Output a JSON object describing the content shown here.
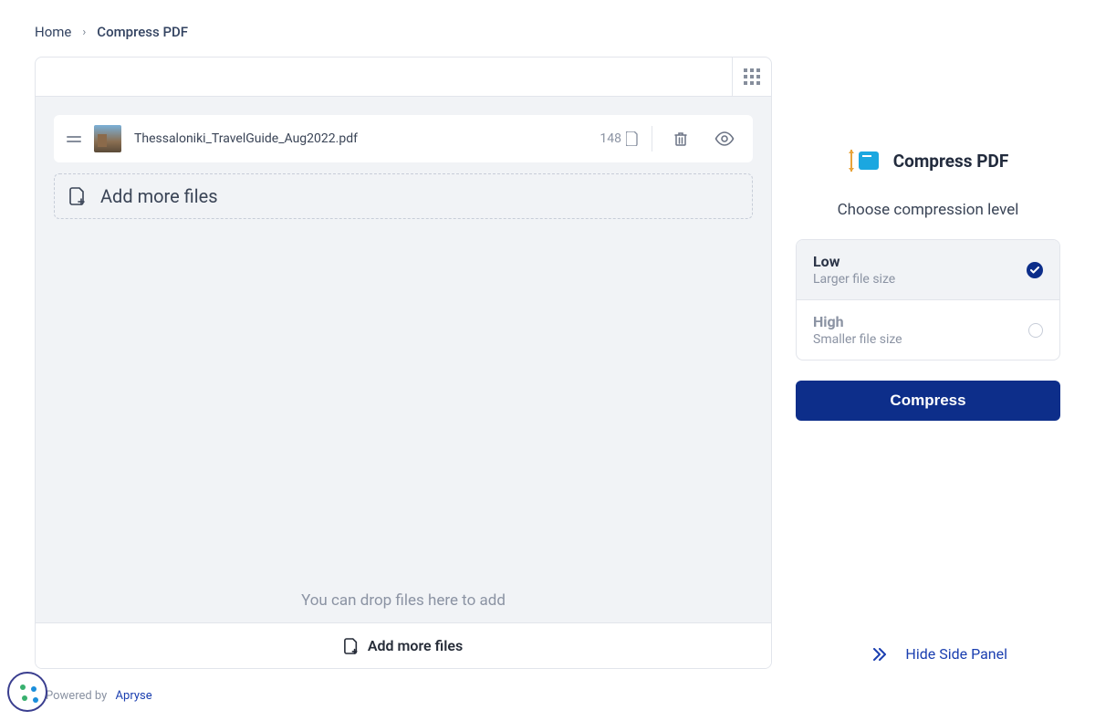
{
  "breadcrumb": {
    "home": "Home",
    "current": "Compress PDF"
  },
  "file": {
    "name": "Thessaloniki_TravelGuide_Aug2022.pdf",
    "pages": "148"
  },
  "addMore": {
    "row_label": "Add more files",
    "footer_label": "Add more files",
    "drop_hint": "You can drop files here to add"
  },
  "side": {
    "title": "Compress PDF",
    "subtitle": "Choose compression level",
    "options": [
      {
        "title": "Low",
        "sub": "Larger file size",
        "selected": true
      },
      {
        "title": "High",
        "sub": "Smaller file size",
        "selected": false
      }
    ],
    "button": "Compress",
    "hide_label": "Hide Side Panel"
  },
  "footer": {
    "powered_prefix": "Powered by",
    "powered_brand": "Apryse"
  },
  "colors": {
    "accent": "#0d2e8a"
  }
}
